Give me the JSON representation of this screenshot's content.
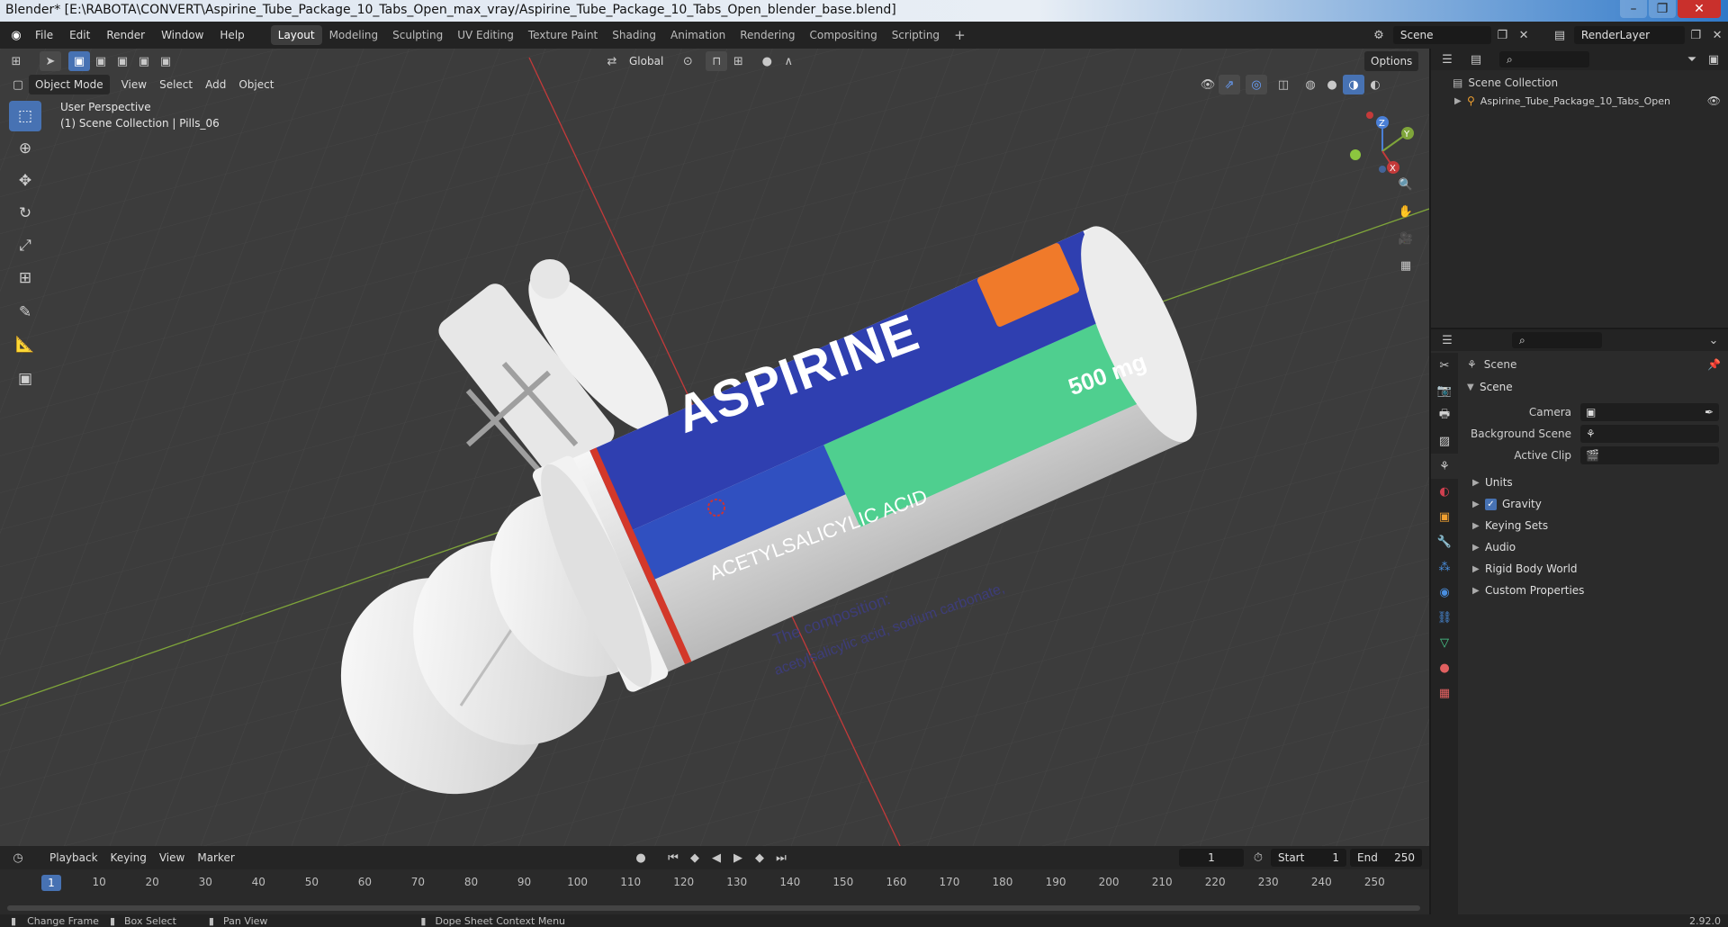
{
  "window": {
    "title": "Blender* [E:\\RABOTA\\CONVERT\\Aspirine_Tube_Package_10_Tabs_Open_max_vray/Aspirine_Tube_Package_10_Tabs_Open_blender_base.blend]",
    "minimize": "–",
    "restore": "❐",
    "close": "✕"
  },
  "menu": {
    "items": [
      "File",
      "Edit",
      "Render",
      "Window",
      "Help"
    ]
  },
  "workspaces": [
    "Layout",
    "Modeling",
    "Sculpting",
    "UV Editing",
    "Texture Paint",
    "Shading",
    "Animation",
    "Rendering",
    "Compositing",
    "Scripting"
  ],
  "workspace_add": "+",
  "scene_selector": {
    "value": "Scene"
  },
  "render_layer": {
    "value": "RenderLayer"
  },
  "viewport": {
    "mode": "Object Mode",
    "menus": [
      "View",
      "Select",
      "Add",
      "Object"
    ],
    "transform_orientation": "Global",
    "options": "Options",
    "overlay_title": "User Perspective",
    "overlay_collection": "(1) Scene Collection | Pills_06",
    "gizmo": {
      "z": "Z",
      "y": "Y",
      "x": "X"
    },
    "object_text": {
      "brand": "ASPIRINE",
      "dose": "500 mg",
      "subtitle": "ACETYLSALICYLIC ACID",
      "composition_title": "The composition:",
      "composition_line": "acetylsalicylic acid, sodium carbonate,"
    }
  },
  "timeline": {
    "menus": [
      "Playback",
      "Keying",
      "View",
      "Marker"
    ],
    "current_frame": "1",
    "start_label": "Start",
    "start_value": "1",
    "end_label": "End",
    "end_value": "250",
    "ruler_current": "1",
    "ruler_ticks": [
      "10",
      "20",
      "30",
      "40",
      "50",
      "60",
      "70",
      "80",
      "90",
      "100",
      "110",
      "120",
      "130",
      "140",
      "150",
      "160",
      "170",
      "180",
      "190",
      "200",
      "210",
      "220",
      "230",
      "240",
      "250"
    ]
  },
  "statusbar": {
    "change_frame": "Change Frame",
    "box_select": "Box Select",
    "pan_view": "Pan View",
    "context_menu": "Dope Sheet Context Menu",
    "version": "2.92.0"
  },
  "outliner": {
    "root": "Scene Collection",
    "items": [
      "Aspirine_Tube_Package_10_Tabs_Open"
    ]
  },
  "properties": {
    "breadcrumb": "Scene",
    "panel_title": "Scene",
    "camera_label": "Camera",
    "background_scene_label": "Background Scene",
    "active_clip_label": "Active Clip",
    "sections": [
      "Units",
      "Gravity",
      "Keying Sets",
      "Audio",
      "Rigid Body World",
      "Custom Properties"
    ]
  },
  "colors": {
    "accent": "#4772b3",
    "axis_x": "#c43a3a",
    "axis_y": "#7fa53a",
    "brand_blue": "#2f3fb0",
    "brand_green": "#4fcf8f",
    "brand_orange": "#f07a2a"
  }
}
